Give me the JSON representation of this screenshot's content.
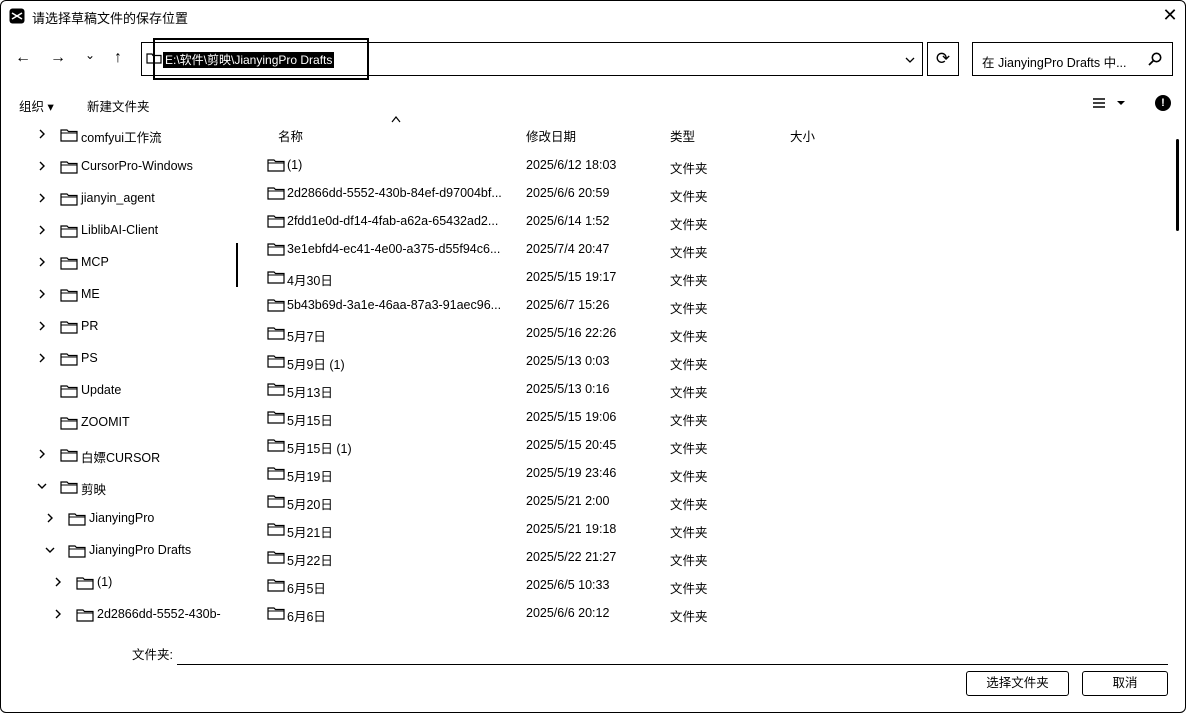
{
  "window": {
    "title": "请选择草稿文件的保存位置",
    "close_symbol": "✕"
  },
  "nav": {
    "back_symbol": "←",
    "forward_symbol": "→",
    "recent_symbol": "⌄",
    "up_symbol": "↑",
    "address_path": "E:\\软件\\剪映\\JianyingPro Drafts",
    "refresh_symbol": "⟳",
    "search_placeholder": "在 JianyingPro Drafts 中..."
  },
  "command_bar": {
    "organize": "组织 ▾",
    "new_folder": "新建文件夹",
    "help_symbol": "!"
  },
  "nav_pane": {
    "items": [
      {
        "label": "comfyui工作流",
        "expand": "right"
      },
      {
        "label": "CursorPro-Windows",
        "expand": "right"
      },
      {
        "label": "jianyin_agent",
        "expand": "right"
      },
      {
        "label": "LiblibAI-Client",
        "expand": "right"
      },
      {
        "label": "MCP",
        "expand": "right"
      },
      {
        "label": "ME",
        "expand": "right"
      },
      {
        "label": "PR",
        "expand": "right"
      },
      {
        "label": "PS",
        "expand": "right"
      },
      {
        "label": "Update",
        "expand": "none"
      },
      {
        "label": "ZOOMIT",
        "expand": "none"
      },
      {
        "label": "白嫖CURSOR",
        "expand": "right"
      },
      {
        "label": "剪映",
        "expand": "down"
      },
      {
        "label": "JianyingPro",
        "expand": "right"
      },
      {
        "label": "JianyingPro Drafts",
        "expand": "down"
      },
      {
        "label": "(1)",
        "expand": "right"
      },
      {
        "label": "2d2866dd-5552-430b-",
        "expand": "right"
      }
    ]
  },
  "file_list": {
    "columns": {
      "name": "名称",
      "modified": "修改日期",
      "type": "类型",
      "size": "大小"
    },
    "rows": [
      {
        "name": "(1)",
        "modified": "2025/6/12 18:03",
        "type": "文件夹"
      },
      {
        "name": "2d2866dd-5552-430b-84ef-d97004bf...",
        "modified": "2025/6/6 20:59",
        "type": "文件夹"
      },
      {
        "name": "2fdd1e0d-df14-4fab-a62a-65432ad2...",
        "modified": "2025/6/14 1:52",
        "type": "文件夹"
      },
      {
        "name": "3e1ebfd4-ec41-4e00-a375-d55f94c6...",
        "modified": "2025/7/4 20:47",
        "type": "文件夹"
      },
      {
        "name": "4月30日",
        "modified": "2025/5/15 19:17",
        "type": "文件夹"
      },
      {
        "name": "5b43b69d-3a1e-46aa-87a3-91aec96...",
        "modified": "2025/6/7 15:26",
        "type": "文件夹"
      },
      {
        "name": "5月7日",
        "modified": "2025/5/16 22:26",
        "type": "文件夹"
      },
      {
        "name": "5月9日 (1)",
        "modified": "2025/5/13 0:03",
        "type": "文件夹"
      },
      {
        "name": "5月13日",
        "modified": "2025/5/13 0:16",
        "type": "文件夹"
      },
      {
        "name": "5月15日",
        "modified": "2025/5/15 19:06",
        "type": "文件夹"
      },
      {
        "name": "5月15日 (1)",
        "modified": "2025/5/15 20:45",
        "type": "文件夹"
      },
      {
        "name": "5月19日",
        "modified": "2025/5/19 23:46",
        "type": "文件夹"
      },
      {
        "name": "5月20日",
        "modified": "2025/5/21 2:00",
        "type": "文件夹"
      },
      {
        "name": "5月21日",
        "modified": "2025/5/21 19:18",
        "type": "文件夹"
      },
      {
        "name": "5月22日",
        "modified": "2025/5/22 21:27",
        "type": "文件夹"
      },
      {
        "name": "6月5日",
        "modified": "2025/6/5 10:33",
        "type": "文件夹"
      },
      {
        "name": "6月6日",
        "modified": "2025/6/6 20:12",
        "type": "文件夹"
      }
    ]
  },
  "footer": {
    "folder_label": "文件夹:",
    "folder_value": "",
    "select_button": "选择文件夹",
    "cancel_button": "取消"
  }
}
